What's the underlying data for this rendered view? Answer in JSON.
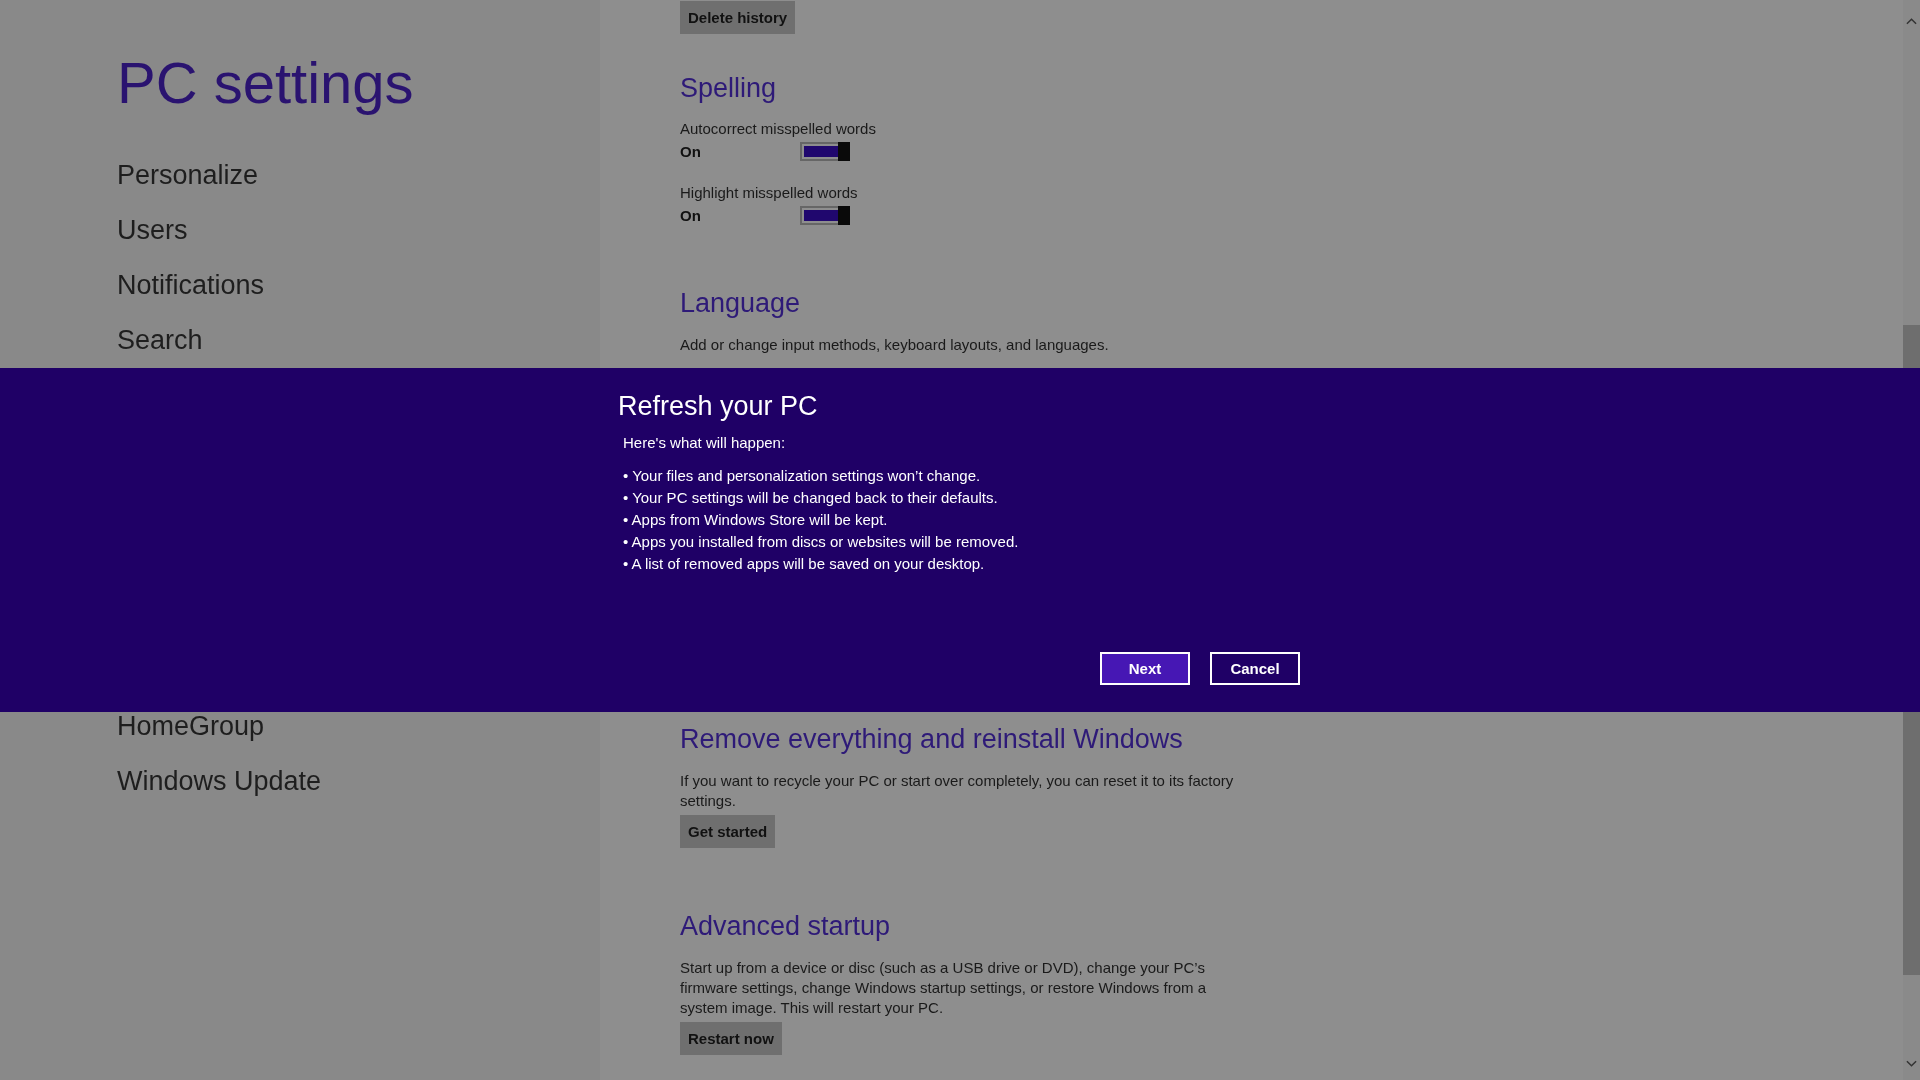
{
  "sidebar": {
    "title": "PC settings",
    "items": [
      {
        "label": "Personalize"
      },
      {
        "label": "Users"
      },
      {
        "label": "Notifications"
      },
      {
        "label": "Search"
      }
    ],
    "items_below": [
      {
        "label": "HomeGroup"
      },
      {
        "label": "Windows Update"
      }
    ]
  },
  "content_top": {
    "button": "Delete history",
    "sections": [
      {
        "heading": "Spelling",
        "toggles": [
          {
            "label": "Autocorrect misspelled words",
            "state": "On",
            "on": true
          },
          {
            "label": "Highlight misspelled words",
            "state": "On",
            "on": true
          }
        ]
      },
      {
        "heading": "Language",
        "text": "Add or change input methods, keyboard layouts, and languages."
      }
    ]
  },
  "content_bottom": [
    {
      "heading": "Remove everything and reinstall Windows",
      "text": "If you want to recycle your PC or start over completely, you can reset it to its factory settings.",
      "button": "Get started"
    },
    {
      "heading": "Advanced startup",
      "text": "Start up from a device or disc (such as a USB drive or DVD), change your PC’s firmware settings, change Windows startup settings, or restore Windows from a system image. This will restart your PC.",
      "button": "Restart now"
    }
  ],
  "dialog": {
    "title": "Refresh your PC",
    "intro": "Here's what will happen:",
    "bullets": [
      "• Your files and personalization settings won’t change.",
      "• Your PC settings will be changed back to their defaults.",
      "• Apps from Windows Store will be kept.",
      "• Apps you installed from discs or websites will be removed.",
      "• A list of removed apps will be saved on your desktop."
    ],
    "buttons": [
      {
        "label": "Next",
        "kind": "primary"
      },
      {
        "label": "Cancel",
        "kind": "secondary"
      }
    ]
  }
}
